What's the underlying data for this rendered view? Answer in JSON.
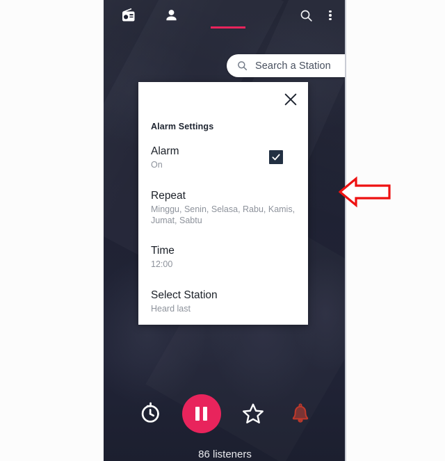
{
  "app": {
    "background_color": "#1f2233",
    "accent_color": "#e8245c"
  },
  "appbar": {
    "tabs": [
      {
        "name": "radio-tab",
        "icon": "radio-icon",
        "active": true
      },
      {
        "name": "profile-tab",
        "icon": "person-icon",
        "active": false
      }
    ],
    "actions": [
      {
        "name": "search-action",
        "icon": "search-icon"
      },
      {
        "name": "overflow-action",
        "icon": "more-vertical-icon"
      }
    ]
  },
  "search": {
    "icon": "search-icon",
    "placeholder": "Search a Station",
    "value": ""
  },
  "dialog": {
    "title": "Alarm Settings",
    "close_icon": "close-icon",
    "rows": [
      {
        "label": "Alarm",
        "value": "On",
        "control": "checkbox",
        "checked": true
      },
      {
        "label": "Repeat",
        "value": "Minggu, Senin, Selasa, Rabu, Kamis, Jumat, Sabtu"
      },
      {
        "label": "Time",
        "value": "12:00"
      },
      {
        "label": "Select Station",
        "value": "Heard last"
      }
    ]
  },
  "player": {
    "controls": [
      {
        "name": "history-button",
        "icon": "history-icon"
      },
      {
        "name": "play-pause-button",
        "icon": "pause-icon",
        "state": "pause"
      },
      {
        "name": "favorite-button",
        "icon": "star-outline-icon"
      },
      {
        "name": "alarm-button",
        "icon": "bell-icon",
        "color": "#c0392b"
      }
    ],
    "listeners_text": "86 listeners"
  },
  "annotation": {
    "arrow": "left-arrow-annotation",
    "color": "#ee1111"
  }
}
